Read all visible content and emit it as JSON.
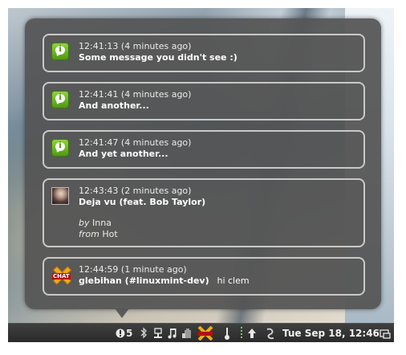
{
  "notifications": [
    {
      "icon": "info-icon",
      "time": "12:41:13 (4 minutes ago)",
      "summary": "Some message you didn't see :)"
    },
    {
      "icon": "info-icon",
      "time": "12:41:41 (4 minutes ago)",
      "summary": "And another..."
    },
    {
      "icon": "info-icon",
      "time": "12:41:47 (4 minutes ago)",
      "summary": "And yet another..."
    },
    {
      "icon": "album-art-icon",
      "time": "12:43:43 (2 minutes ago)",
      "summary": "Deja vu (feat. Bob Taylor)",
      "by_label": "by",
      "artist": "Inna",
      "from_label": "from",
      "album": "Hot"
    },
    {
      "icon": "xchat-icon",
      "icon_text": "CHAT",
      "time": "12:44:59 (1 minute ago)",
      "summary": "glebihan (#linuxmint-dev)",
      "message": "hi clem"
    }
  ],
  "panel": {
    "notification_count": "5",
    "clock": "Tue Sep 18, 12:46",
    "tray_icons": [
      "notification-alert-icon",
      "bluetooth-icon",
      "network-icon",
      "music-note-icon",
      "battery-icon",
      "xchat-tray-icon",
      "volume-icon",
      "separator-handle-icon",
      "update-arrow-icon",
      "power-icon",
      "show-desktop-icon"
    ]
  },
  "colors": {
    "popup_bg": "#545454",
    "note_border": "#c9c9c9",
    "info_green": "#6cb825",
    "panel_bg": "#333333"
  }
}
